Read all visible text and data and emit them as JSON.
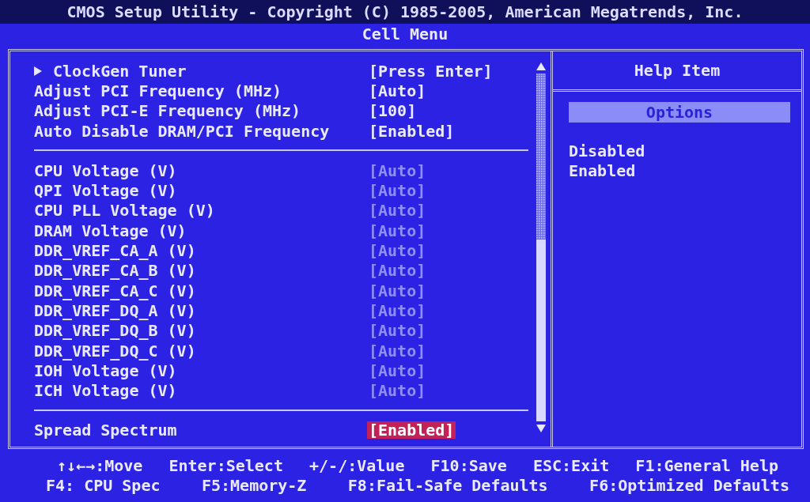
{
  "header": {
    "title": "CMOS Setup Utility - Copyright (C) 1985-2005, American Megatrends, Inc.",
    "menu": "Cell Menu"
  },
  "settings": {
    "groups": [
      {
        "items": [
          {
            "kind": "submenu",
            "label": "ClockGen Tuner",
            "value": "[Press Enter]",
            "disabled": false,
            "selected": false
          },
          {
            "kind": "setting",
            "label": "Adjust PCI Frequency (MHz)",
            "value": "[Auto]",
            "disabled": false,
            "selected": false
          },
          {
            "kind": "setting",
            "label": "Adjust PCI-E Frequency (MHz)",
            "value": "[100]",
            "disabled": false,
            "selected": false
          },
          {
            "kind": "setting",
            "label": "Auto Disable DRAM/PCI Frequency",
            "value": "[Enabled]",
            "disabled": false,
            "selected": false
          }
        ]
      },
      {
        "items": [
          {
            "kind": "setting",
            "label": "CPU Voltage (V)",
            "value": "[Auto]",
            "disabled": true,
            "selected": false
          },
          {
            "kind": "setting",
            "label": "QPI Voltage (V)",
            "value": "[Auto]",
            "disabled": true,
            "selected": false
          },
          {
            "kind": "setting",
            "label": "CPU PLL Voltage (V)",
            "value": "[Auto]",
            "disabled": true,
            "selected": false
          },
          {
            "kind": "setting",
            "label": "DRAM Voltage (V)",
            "value": "[Auto]",
            "disabled": true,
            "selected": false
          },
          {
            "kind": "setting",
            "label": "DDR_VREF_CA_A (V)",
            "value": "[Auto]",
            "disabled": true,
            "selected": false
          },
          {
            "kind": "setting",
            "label": "DDR_VREF_CA_B (V)",
            "value": "[Auto]",
            "disabled": true,
            "selected": false
          },
          {
            "kind": "setting",
            "label": "DDR_VREF_CA_C (V)",
            "value": "[Auto]",
            "disabled": true,
            "selected": false
          },
          {
            "kind": "setting",
            "label": "DDR_VREF_DQ_A (V)",
            "value": "[Auto]",
            "disabled": true,
            "selected": false
          },
          {
            "kind": "setting",
            "label": "DDR_VREF_DQ_B (V)",
            "value": "[Auto]",
            "disabled": true,
            "selected": false
          },
          {
            "kind": "setting",
            "label": "DDR_VREF_DQ_C (V)",
            "value": "[Auto]",
            "disabled": true,
            "selected": false
          },
          {
            "kind": "setting",
            "label": "IOH Voltage (V)",
            "value": "[Auto]",
            "disabled": true,
            "selected": false
          },
          {
            "kind": "setting",
            "label": "ICH Voltage (V)",
            "value": "[Auto]",
            "disabled": true,
            "selected": false
          }
        ]
      },
      {
        "items": [
          {
            "kind": "setting",
            "label": "Spread Spectrum",
            "value": "[Enabled]",
            "disabled": false,
            "selected": true
          }
        ]
      }
    ]
  },
  "help": {
    "title": "Help Item",
    "options_label": "Options",
    "options": [
      "Disabled",
      "Enabled"
    ]
  },
  "footer": {
    "lines": [
      {
        "keys": [
          "↑↓←→:Move",
          "Enter:Select",
          "+/-/:Value",
          "F10:Save",
          "ESC:Exit",
          "F1:General Help"
        ]
      },
      {
        "keys": [
          "F4: CPU Spec",
          "F5:Memory-Z",
          "F8:Fail-Safe Defaults",
          "F6:Optimized Defaults"
        ]
      }
    ]
  }
}
